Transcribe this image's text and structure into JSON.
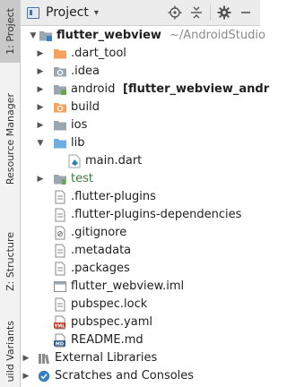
{
  "window": {
    "title": "Project",
    "dropdown_glyph": "▾"
  },
  "side_tabs": [
    {
      "label": "1: Project",
      "active": true
    },
    {
      "label": "Resource Manager",
      "active": false
    },
    {
      "label": "Z: Structure",
      "active": false
    },
    {
      "label": "uild Variants",
      "active": false
    }
  ],
  "header_icons": [
    "crosshair-icon",
    "collapse-icon",
    "gear-icon",
    "minimize-icon"
  ],
  "tree": {
    "root": {
      "name": "flutter_webview",
      "path": "~/AndroidStudio"
    },
    "items": [
      {
        "name": ".dart_tool",
        "icon": "folder-orange"
      },
      {
        "name": ".idea",
        "icon": "folder-settings"
      },
      {
        "name": "android",
        "suffix": "[flutter_webview_andr",
        "icon": "folder-android"
      },
      {
        "name": "build",
        "icon": "folder-build"
      },
      {
        "name": "ios",
        "icon": "folder-gray"
      },
      {
        "name": "lib",
        "icon": "folder-blue"
      },
      {
        "name": "main.dart",
        "icon": "dart-file"
      },
      {
        "name": "test",
        "icon": "folder-test"
      },
      {
        "name": ".flutter-plugins",
        "icon": "text-file"
      },
      {
        "name": ".flutter-plugins-dependencies",
        "icon": "text-file"
      },
      {
        "name": ".gitignore",
        "icon": "gitignore-file"
      },
      {
        "name": ".metadata",
        "icon": "text-file"
      },
      {
        "name": ".packages",
        "icon": "text-file"
      },
      {
        "name": "flutter_webview.iml",
        "icon": "iml-file"
      },
      {
        "name": "pubspec.lock",
        "icon": "text-file"
      },
      {
        "name": "pubspec.yaml",
        "icon": "yaml-file",
        "badge": "YML"
      },
      {
        "name": "README.md",
        "icon": "md-file",
        "badge": "MD"
      },
      {
        "name": "External Libraries",
        "icon": "libraries-icon"
      },
      {
        "name": "Scratches and Consoles",
        "icon": "scratches-icon"
      }
    ]
  },
  "colors": {
    "folder_gray": "#9aa7b0",
    "folder_orange": "#f4a15d",
    "folder_blue": "#6eaee0",
    "accent_blue": "#3a7fc1",
    "android_green": "#6aa84f"
  }
}
